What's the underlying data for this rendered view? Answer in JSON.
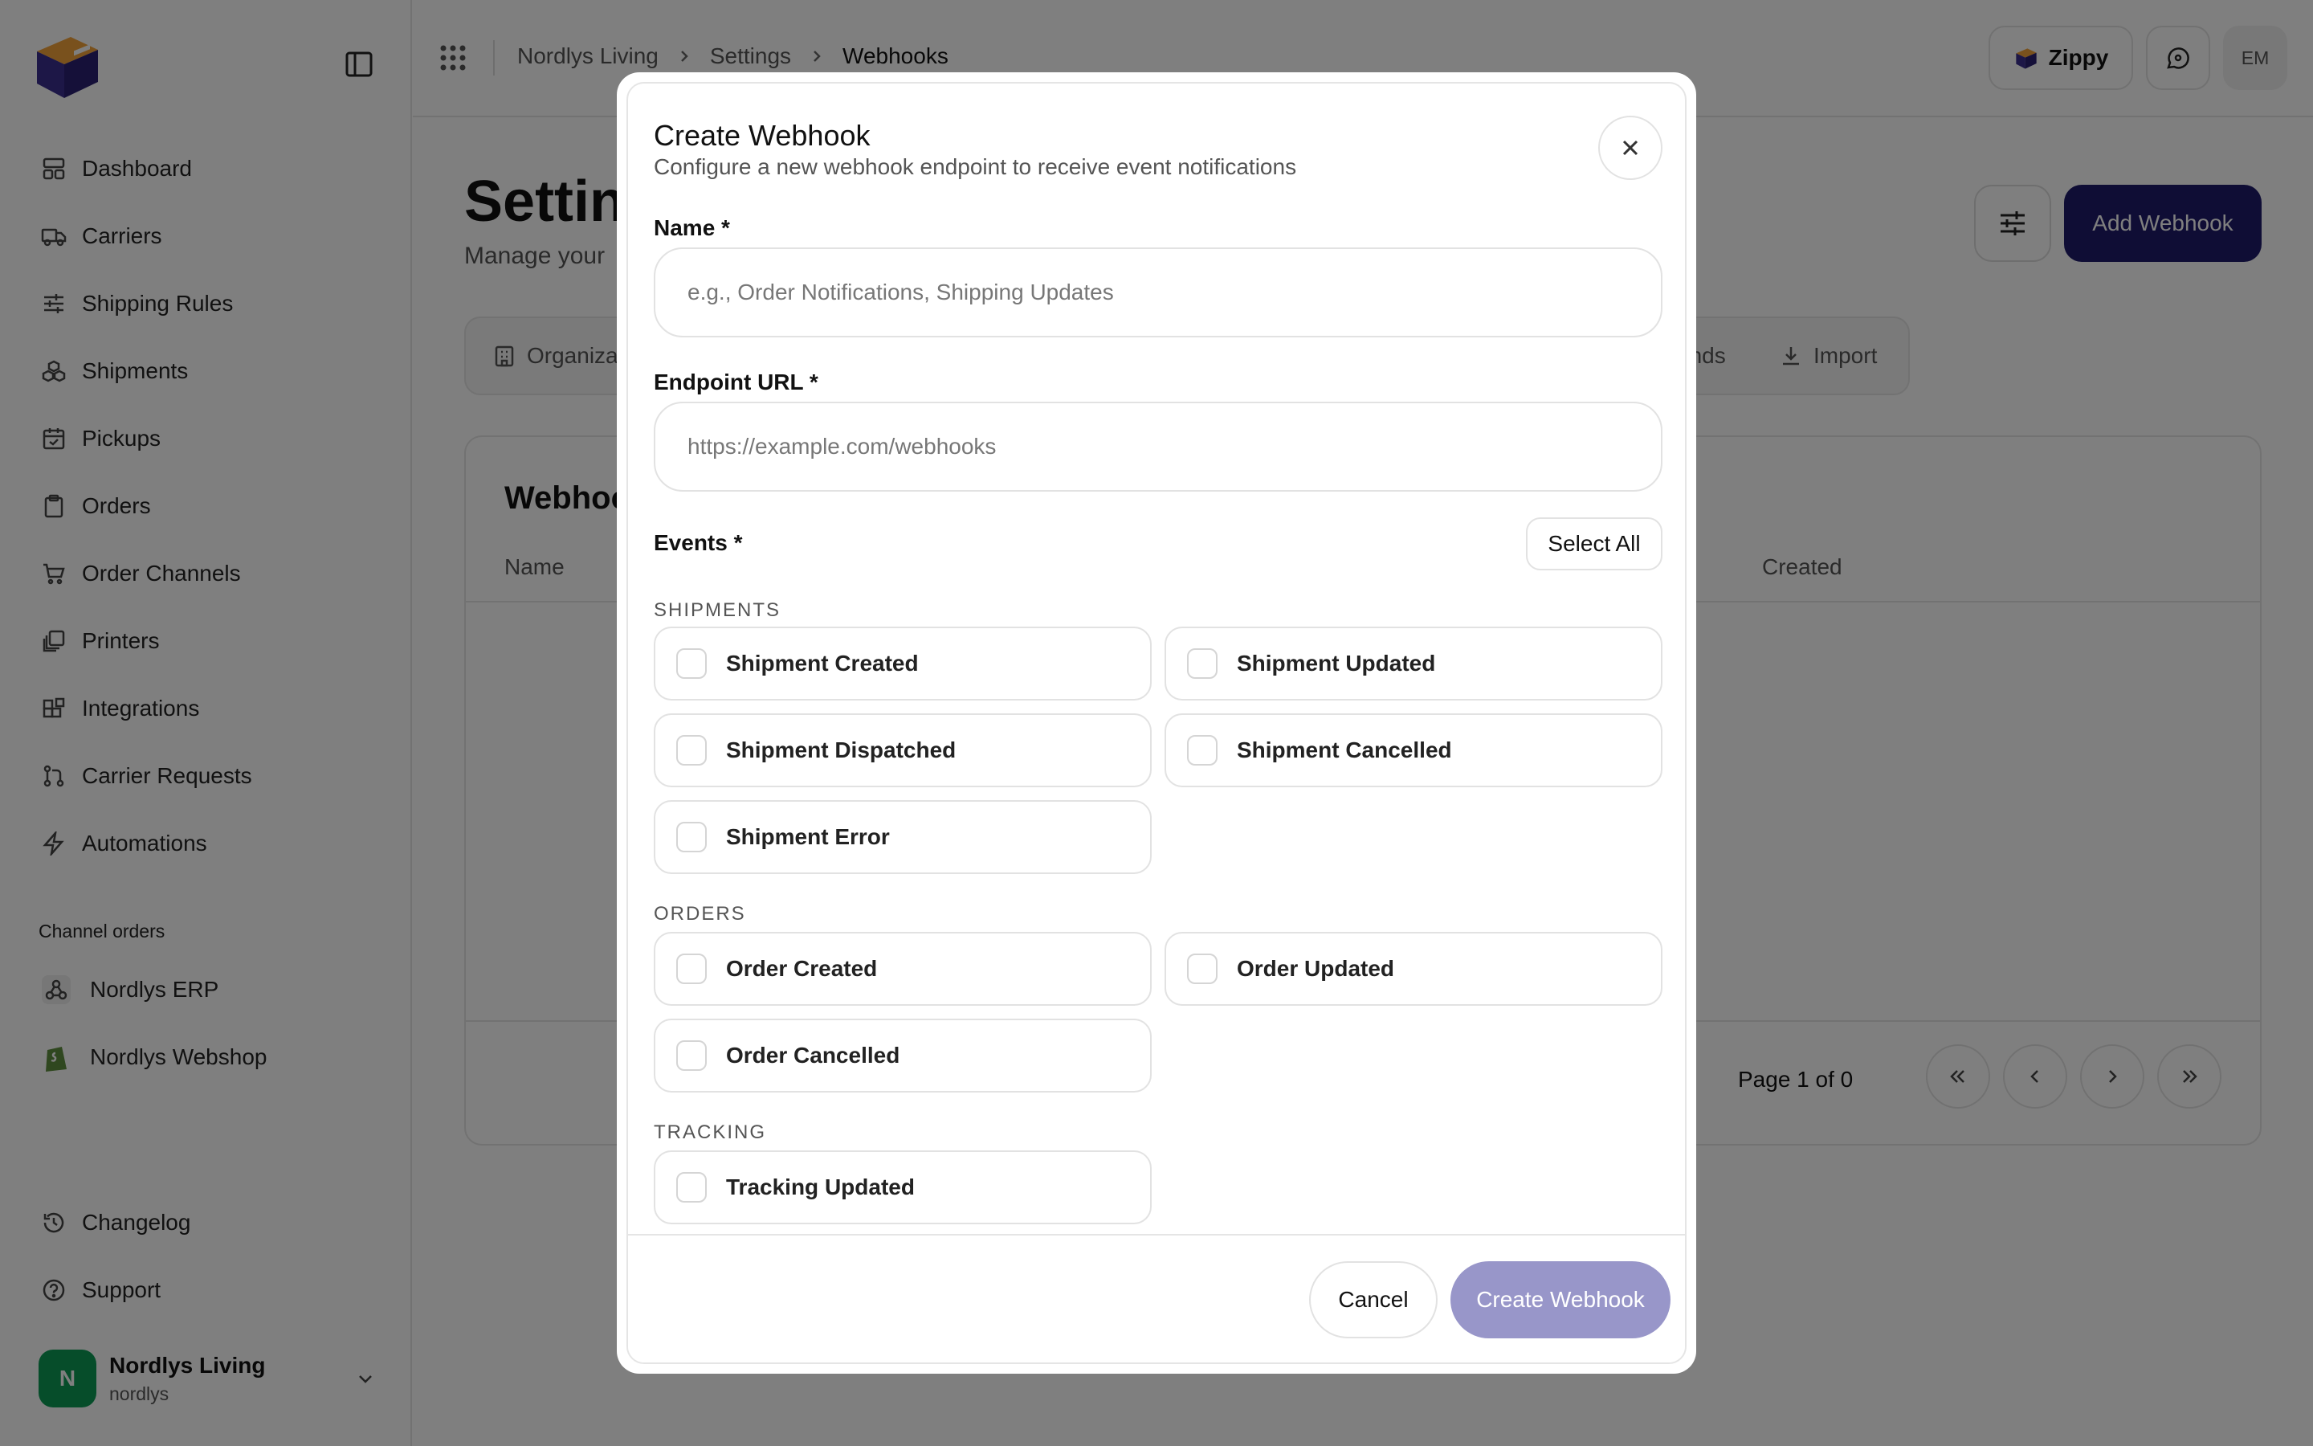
{
  "breadcrumb": {
    "org": "Nordlys Living",
    "settings": "Settings",
    "current": "Webhooks"
  },
  "topbar": {
    "zippy_label": "Zippy",
    "user_initials": "EM"
  },
  "sidebar": {
    "items": [
      {
        "label": "Dashboard",
        "icon": "dashboard-icon"
      },
      {
        "label": "Carriers",
        "icon": "truck-icon"
      },
      {
        "label": "Shipping Rules",
        "icon": "sliders-icon"
      },
      {
        "label": "Shipments",
        "icon": "boxes-icon"
      },
      {
        "label": "Pickups",
        "icon": "calendar-check-icon"
      },
      {
        "label": "Orders",
        "icon": "clipboard-icon"
      },
      {
        "label": "Order Channels",
        "icon": "cart-icon"
      },
      {
        "label": "Printers",
        "icon": "printer-icon"
      },
      {
        "label": "Integrations",
        "icon": "blocks-icon"
      },
      {
        "label": "Carrier Requests",
        "icon": "git-pull-request-icon"
      },
      {
        "label": "Automations",
        "icon": "zap-icon"
      }
    ],
    "channel_section_label": "Channel orders",
    "channels": [
      {
        "label": "Nordlys ERP",
        "icon": "webhook-icon"
      },
      {
        "label": "Nordlys Webshop",
        "icon": "shopify-icon"
      }
    ],
    "bottom": [
      {
        "label": "Changelog",
        "icon": "history-icon"
      },
      {
        "label": "Support",
        "icon": "help-circle-icon"
      }
    ],
    "user": {
      "initial": "N",
      "name": "Nordlys Living",
      "handle": "nordlys"
    }
  },
  "page": {
    "title": "Settin",
    "subtitle": "Manage your",
    "add_button": "Add Webhook",
    "tabs": {
      "first": "Organiza",
      "brands": "ands",
      "import": "Import"
    },
    "card_title": "Webhoo",
    "columns": {
      "name": "Name",
      "created": "Created"
    },
    "pagination": "Page 1 of 0"
  },
  "modal": {
    "title": "Create Webhook",
    "subtitle": "Configure a new webhook endpoint to receive event notifications",
    "name_label": "Name *",
    "name_placeholder": "e.g., Order Notifications, Shipping Updates",
    "name_value": "",
    "url_label": "Endpoint URL *",
    "url_placeholder": "https://example.com/webhooks",
    "url_value": "",
    "events_label": "Events *",
    "select_all": "Select All",
    "groups": {
      "shipments": {
        "label": "SHIPMENTS",
        "events": [
          "Shipment Created",
          "Shipment Updated",
          "Shipment Dispatched",
          "Shipment Cancelled",
          "Shipment Error"
        ]
      },
      "orders": {
        "label": "ORDERS",
        "events": [
          "Order Created",
          "Order Updated",
          "Order Cancelled"
        ]
      },
      "tracking": {
        "label": "TRACKING",
        "events": [
          "Tracking Updated"
        ]
      }
    },
    "cancel": "Cancel",
    "create": "Create Webhook"
  },
  "colors": {
    "primary": "#1e1b6b",
    "create_disabled": "#9896c9",
    "avatar": "#0c9a55"
  }
}
